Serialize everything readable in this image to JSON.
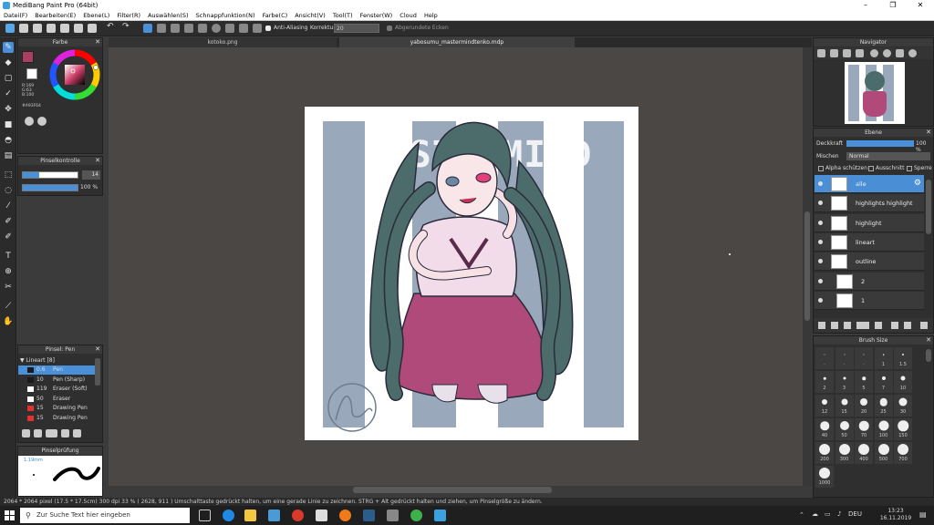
{
  "window": {
    "title": "MediBang Paint Pro (64bit)",
    "controls": [
      "–",
      "❐",
      "✕"
    ]
  },
  "menu": [
    "Datei(F)",
    "Bearbeiten(E)",
    "Ebene(L)",
    "Filter(R)",
    "Auswählen(S)",
    "Schnappfunktion(N)",
    "Farbe(C)",
    "Ansicht(V)",
    "Tool(T)",
    "Fenster(W)",
    "Cloud",
    "Help"
  ],
  "toolbar": {
    "antialias_label": "Anti-Aliasing",
    "korrektur_label": "Korrektur",
    "korrektur_value": "20",
    "rounded_label": "Abgerundete Ecken"
  },
  "tabs": [
    {
      "label": "kotoko.png",
      "active": false
    },
    {
      "label": "yabosumu_mastermindtenko.mdp",
      "active": true
    }
  ],
  "farbe": {
    "title": "Farbe",
    "primary_color": "#A93F64",
    "r_label": "R:169",
    "g_label": "G:63",
    "b_label": "B:100",
    "hex_label": "#A93F64"
  },
  "pinselkontrolle": {
    "title": "Pinselkontrolle",
    "size_value": "14",
    "opacity_value": "100 %"
  },
  "pinsel": {
    "title": "Pinsel: Pen",
    "group": "Lineart [8]",
    "brushes": [
      {
        "size": "0.6",
        "name": "Pen",
        "color": "#1a1a1a",
        "active": true
      },
      {
        "size": "10",
        "name": "Pen (Sharp)",
        "color": "#1a1a1a",
        "active": false
      },
      {
        "size": "119",
        "name": "Eraser (Soft)",
        "color": "#ffffff",
        "active": false
      },
      {
        "size": "50",
        "name": "Eraser",
        "color": "#ffffff",
        "active": false
      },
      {
        "size": "15",
        "name": "Drawing Pen",
        "color": "#e0332f",
        "active": false
      },
      {
        "size": "15",
        "name": "Drawing Pen",
        "color": "#e0332f",
        "active": false
      }
    ]
  },
  "pinselpruefung": {
    "title": "Pinselprüfung",
    "size_label": "1.19mm"
  },
  "canvas": {
    "watermark_text": "MASTERMIND"
  },
  "navigator": {
    "title": "Navigator"
  },
  "ebene": {
    "title": "Ebene",
    "deckkraft_label": "Deckkraft",
    "deckkraft_value": "100 %",
    "deckkraft_fraction": 1.0,
    "mischen_label": "Mischen",
    "mischen_value": "Normal",
    "alpha_label": "Alpha schützen",
    "ausschnitt_label": "Ausschnitt",
    "sperre_label": "Sperre",
    "layers": [
      {
        "name": "alle",
        "active": true
      },
      {
        "name": "highlights highlight",
        "active": false
      },
      {
        "name": "highlight",
        "active": false
      },
      {
        "name": "lineart",
        "active": false
      },
      {
        "name": "outline",
        "active": false
      },
      {
        "name": "2",
        "active": false
      },
      {
        "name": "1",
        "active": false
      }
    ]
  },
  "brush_size": {
    "title": "Brush Size",
    "sizes": [
      "·",
      "·",
      "·",
      "1",
      "1.5",
      "2",
      "3",
      "5",
      "7",
      "10",
      "12",
      "15",
      "20",
      "25",
      "30",
      "40",
      "50",
      "70",
      "100",
      "150",
      "200",
      "300",
      "400",
      "500",
      "700",
      "1000"
    ]
  },
  "status": {
    "text": "2064 * 2064 pixel   (17.5 * 17.5cm)   300 dpi   33 %   ( 2628, 911 )   Umschalttaste gedrückt halten, um eine gerade Linie zu zeichnen. STRG + Alt gedrückt halten und ziehen, um Pinselgröße zu ändern."
  },
  "taskbar": {
    "search_placeholder": "Zur Suche Text hier eingeben",
    "lang": "DEU",
    "time": "13:23",
    "date": "16.11.2019"
  }
}
